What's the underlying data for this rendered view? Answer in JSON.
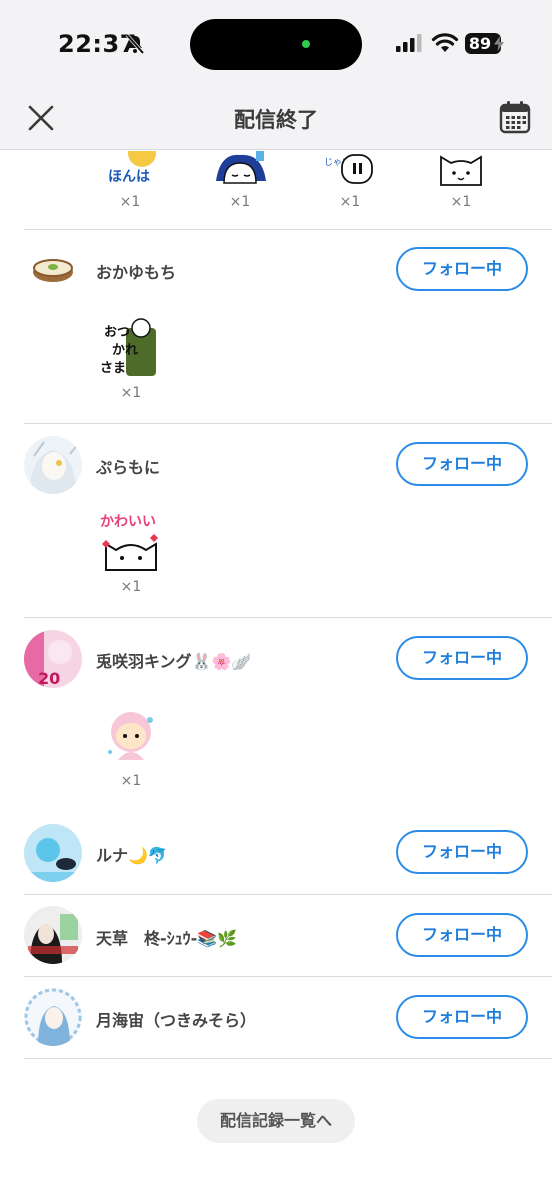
{
  "status_bar": {
    "time": "22:37",
    "battery": "89",
    "icons": [
      "bell-slash-icon",
      "cellular-signal-icon",
      "wifi-icon",
      "battery-icon"
    ]
  },
  "header": {
    "title": "配信終了",
    "close_icon": "close-icon",
    "calendar_icon": "calendar-icon"
  },
  "top_stamps": [
    {
      "count": "×1"
    },
    {
      "count": "×1"
    },
    {
      "count": "×1"
    },
    {
      "count": "×1"
    }
  ],
  "users": [
    {
      "name": "おかゆもち",
      "follow_label": "フォロー中",
      "gift_count": "×1"
    },
    {
      "name": "ぷらもに",
      "follow_label": "フォロー中",
      "gift_count": "×1"
    },
    {
      "name": "兎咲羽キング🐰🌸🪽",
      "follow_label": "フォロー中",
      "gift_count": "×1"
    },
    {
      "name": "ルナ🌙🐬",
      "follow_label": "フォロー中"
    },
    {
      "name": "天草　柊-ｼｭｳ-📚🌿",
      "follow_label": "フォロー中"
    },
    {
      "name": "月海宙（つきみそら）",
      "follow_label": "フォロー中"
    }
  ],
  "footer": {
    "records_label": "配信記録一覧へ"
  },
  "colors": {
    "accent": "#2a8ce6",
    "header_bg": "#f3f3f5"
  }
}
